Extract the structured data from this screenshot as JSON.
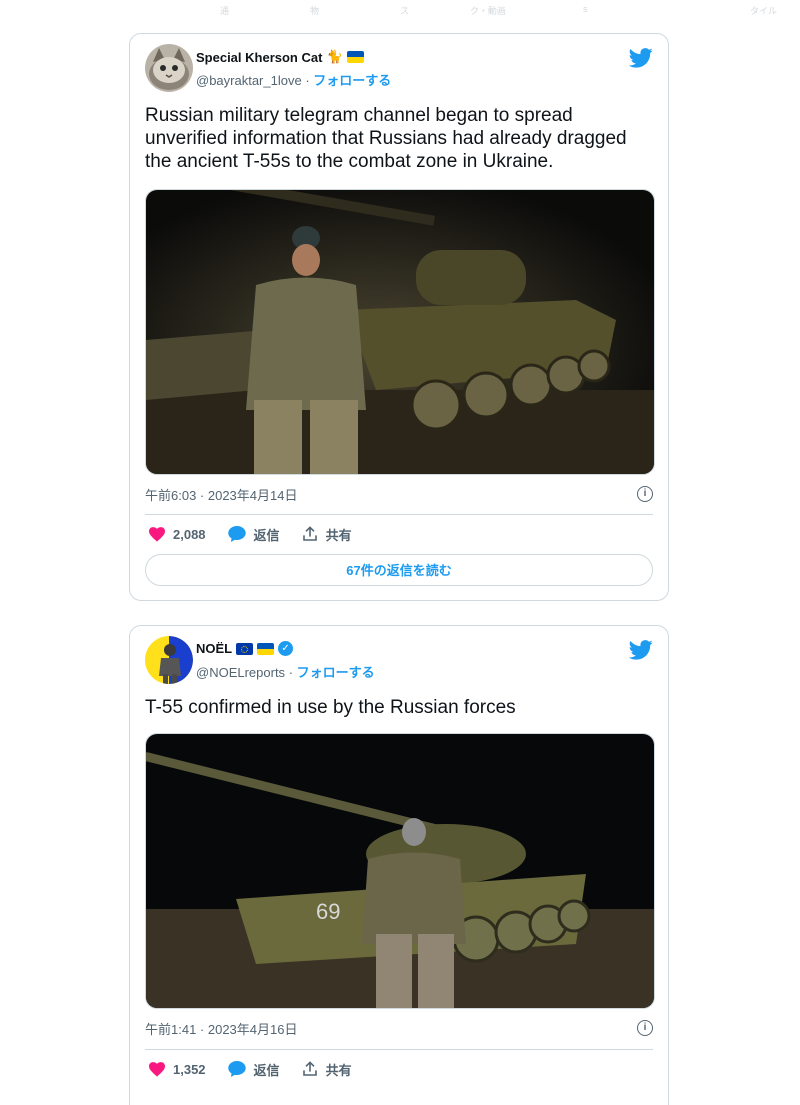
{
  "topnav": [
    "通",
    "物",
    "ス",
    "ク・動画",
    "s",
    "タイル"
  ],
  "tweets": [
    {
      "display_name": "Special Kherson Cat",
      "handle": "@bayraktar_1love",
      "separator": "·",
      "follow_label": "フォローする",
      "text_lines": [
        "Russian military telegram channel began to spread",
        "unverified information that Russians had already dragged",
        "the ancient T-55s to the combat zone in Ukraine."
      ],
      "timestamp": "午前6:03 · 2023年4月14日",
      "likes": "2,088",
      "reply_label": "返信",
      "share_label": "共有",
      "read_replies_label": "67件の返信を読む"
    },
    {
      "display_name": "NOËL",
      "handle": "@NOELreports",
      "separator": "·",
      "follow_label": "フォローする",
      "text_lines": [
        "T-55 confirmed in use by the Russian forces"
      ],
      "timestamp": "午前1:41 · 2023年4月16日",
      "likes": "1,352",
      "reply_label": "返信",
      "share_label": "共有"
    }
  ],
  "colors": {
    "twitter_blue": "#1d9bf0",
    "like_pink": "#f91880",
    "secondary_text": "#536471",
    "border": "#cfd9de"
  },
  "icons": [
    "twitter-bird-icon",
    "heart-icon",
    "reply-bubble-icon",
    "share-icon",
    "info-icon",
    "verified-badge-icon",
    "ukraine-flag-icon",
    "eu-flag-icon",
    "cat-emoji-icon"
  ]
}
